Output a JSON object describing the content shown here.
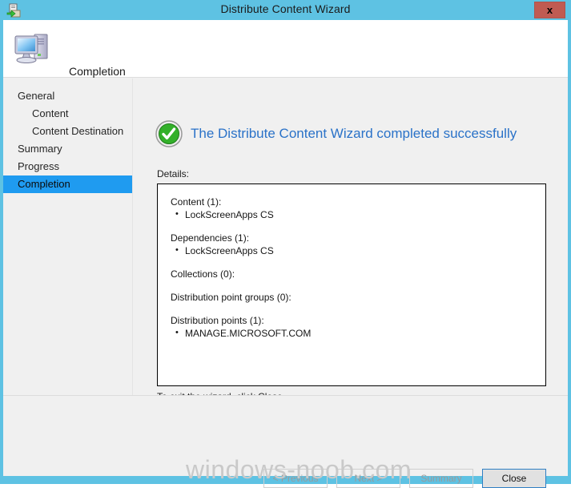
{
  "window": {
    "title": "Distribute Content Wizard",
    "icon": "distribute-content-icon",
    "close_label": "x"
  },
  "banner": {
    "icon": "computer-icon",
    "title": "Completion"
  },
  "sidebar": {
    "items": [
      {
        "label": "General",
        "level": 0,
        "selected": false
      },
      {
        "label": "Content",
        "level": 1,
        "selected": false
      },
      {
        "label": "Content Destination",
        "level": 1,
        "selected": false
      },
      {
        "label": "Summary",
        "level": 0,
        "selected": false
      },
      {
        "label": "Progress",
        "level": 0,
        "selected": false
      },
      {
        "label": "Completion",
        "level": 0,
        "selected": true
      }
    ],
    "selected_color": "#1f9bf0"
  },
  "main": {
    "status_icon": "success-check-icon",
    "status_text": "The Distribute Content Wizard completed successfully",
    "status_color": "#2a72c8",
    "details_label": "Details:",
    "details": [
      {
        "heading": "Content (1):",
        "items": [
          "LockScreenApps CS"
        ]
      },
      {
        "heading": "Dependencies (1):",
        "items": [
          "LockScreenApps CS"
        ]
      },
      {
        "heading": "Collections (0):",
        "items": []
      },
      {
        "heading": "Distribution point groups (0):",
        "items": []
      },
      {
        "heading": "Distribution points (1):",
        "items": [
          "MANAGE.MICROSOFT.COM"
        ]
      }
    ],
    "exit_note": "To exit the wizard, click Close."
  },
  "footer": {
    "previous_label": "< Previous",
    "next_label": "Next >",
    "summary_label": "Summary",
    "close_label": "Close"
  },
  "watermark": {
    "text": "windows-noob.com"
  }
}
